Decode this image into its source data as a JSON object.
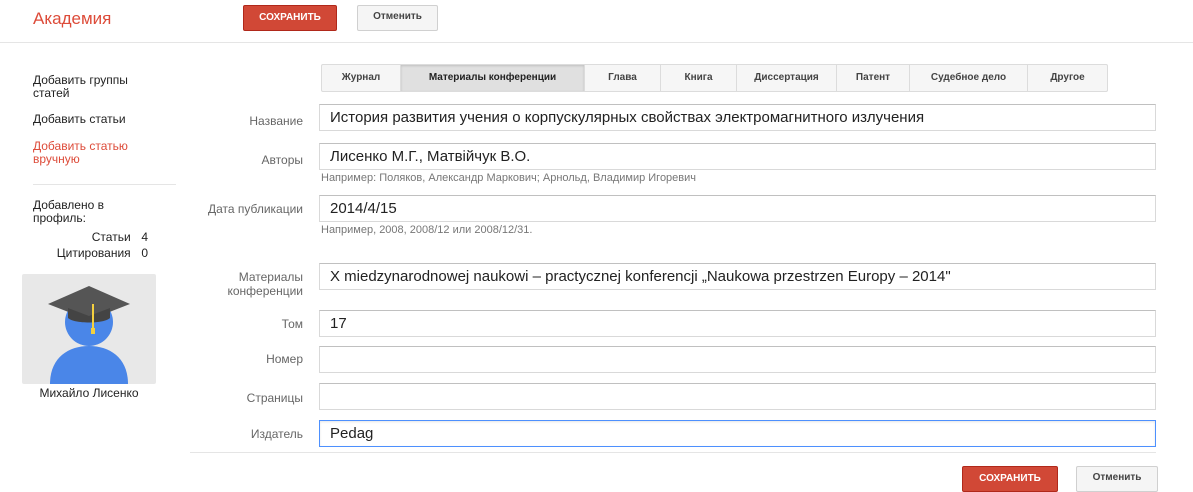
{
  "app": {
    "title": "Академия"
  },
  "toolbar": {
    "save_label": "СОХРАНИТЬ",
    "cancel_label": "Отменить"
  },
  "sidebar": {
    "items": [
      {
        "label": "Добавить группы статей"
      },
      {
        "label": "Добавить статьи"
      },
      {
        "label": "Добавить статью вручную"
      }
    ],
    "added_heading": "Добавлено в профиль:",
    "stats": [
      {
        "label": "Статьи",
        "value": "4"
      },
      {
        "label": "Цитирования",
        "value": "0"
      }
    ],
    "profile_name": "Михайло Лисенко"
  },
  "tabs": [
    {
      "label": "Журнал",
      "active": false
    },
    {
      "label": "Материалы конференции",
      "active": true
    },
    {
      "label": "Глава",
      "active": false
    },
    {
      "label": "Книга",
      "active": false
    },
    {
      "label": "Диссертация",
      "active": false
    },
    {
      "label": "Патент",
      "active": false
    },
    {
      "label": "Судебное дело",
      "active": false
    },
    {
      "label": "Другое",
      "active": false
    }
  ],
  "form": {
    "title": {
      "label": "Название",
      "value": "История развития учения о корпускулярных свойствах электромагнитного излучения"
    },
    "authors": {
      "label": "Авторы",
      "value": "Лисенко М.Г., Матвійчук В.О.",
      "hint": "Например: Поляков, Александр Маркович; Арнольд, Владимир Игоревич"
    },
    "date": {
      "label": "Дата публикации",
      "value": "2014/4/15",
      "hint": "Например, 2008, 2008/12 или 2008/12/31."
    },
    "conference": {
      "label": "Материалы конференции",
      "value": "X miedzynarodnowej naukowi – practycznej konferencji „Naukowa przestrzen Europy – 2014\""
    },
    "volume": {
      "label": "Том",
      "value": "17"
    },
    "issue": {
      "label": "Номер",
      "value": ""
    },
    "pages": {
      "label": "Страницы",
      "value": ""
    },
    "publisher": {
      "label": "Издатель",
      "value": "Pedag"
    }
  },
  "colors": {
    "accent": "#dd4b39",
    "save_button": "#d14836",
    "focus": "#4d90fe"
  }
}
